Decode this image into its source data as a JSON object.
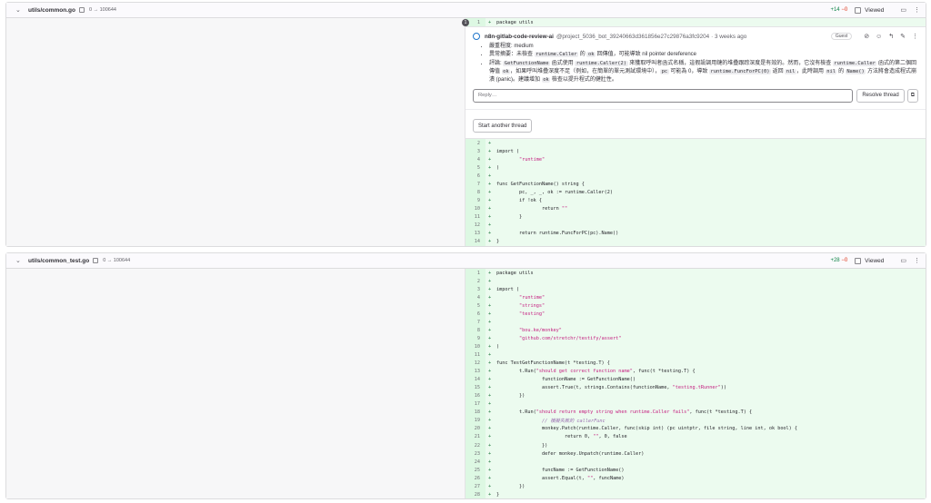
{
  "file1": {
    "name": "utils/common.go",
    "mode": "0 → 100644",
    "added": "+14",
    "removed": "−0",
    "viewed_label": "Viewed",
    "first_line": {
      "num": "1",
      "code": "package utils"
    },
    "comment_count": "1",
    "note": {
      "author": "n8n-gitlab-code-review-ai",
      "handle": "@project_5036_bot_39240663d361856e27c29876a3fc9204",
      "time": "· 3 weeks ago",
      "badge": "Guest",
      "bullet1": "嚴重程度: medium",
      "bullet2_pre": "異常摘要：未檢查 ",
      "bullet2_code1": "runtime.Caller",
      "bullet2_mid": " 的 ",
      "bullet2_code2": "ok",
      "bullet2_post": " 回傳值，可能導致 nil pointer dereference",
      "bullet3_a": "評論: ",
      "bullet3_c1": "GetFunctionName",
      "bullet3_b": " 函式使用 ",
      "bullet3_c2": "runtime.Caller(2)",
      "bullet3_d": " 來獲取呼叫者函式名稱，這假設調用鏈的堆疊跟踪深度是有效的。然而，它沒有檢查 ",
      "bullet3_c3": "runtime.Caller",
      "bullet3_e": " 函式的第二個回傳值 ",
      "bullet3_c4": "ok",
      "bullet3_f": "，如果呼叫堆疊深度不足（例如，在簡單的單元測試環境中），",
      "bullet3_c5": "pc",
      "bullet3_g": " 可能為 0，導致 ",
      "bullet3_c6": "runtime.FuncForPC(0)",
      "bullet3_h": " 返回 ",
      "bullet3_c7": "nil",
      "bullet3_i": "，此時調用 ",
      "bullet3_c8": "nil",
      "bullet3_j": " 的 ",
      "bullet3_c9": "Name()",
      "bullet3_k": " 方法將會造成程式崩潰 (panic)。建議增加 ",
      "bullet3_c10": "ok",
      "bullet3_l": " 檢查以提升程式的健壯性。",
      "reply_placeholder": "Reply…",
      "resolve_label": "Resolve thread",
      "start_thread_label": "Start another thread"
    },
    "lines": [
      {
        "num": "2",
        "parts": [
          {
            "t": ""
          }
        ]
      },
      {
        "num": "3",
        "parts": [
          {
            "t": "import ("
          }
        ]
      },
      {
        "num": "4",
        "parts": [
          {
            "t": "        "
          },
          {
            "t": "\"runtime\"",
            "c": "str"
          }
        ]
      },
      {
        "num": "5",
        "parts": [
          {
            "t": ")"
          }
        ]
      },
      {
        "num": "6",
        "parts": [
          {
            "t": ""
          }
        ]
      },
      {
        "num": "7",
        "parts": [
          {
            "t": "func GetFunctionName() string {"
          }
        ]
      },
      {
        "num": "8",
        "parts": [
          {
            "t": "        pc, _, _, ok := runtime.Caller(2)"
          }
        ]
      },
      {
        "num": "9",
        "parts": [
          {
            "t": "        if !ok {"
          }
        ]
      },
      {
        "num": "10",
        "parts": [
          {
            "t": "                return "
          },
          {
            "t": "\"\"",
            "c": "str"
          }
        ]
      },
      {
        "num": "11",
        "parts": [
          {
            "t": "        }"
          }
        ]
      },
      {
        "num": "12",
        "parts": [
          {
            "t": ""
          }
        ]
      },
      {
        "num": "13",
        "parts": [
          {
            "t": "        return runtime.FuncForPC(pc).Name()"
          }
        ]
      },
      {
        "num": "14",
        "parts": [
          {
            "t": "}"
          }
        ]
      }
    ]
  },
  "file2": {
    "name": "utils/common_test.go",
    "mode": "0 → 100644",
    "added": "+28",
    "removed": "−0",
    "viewed_label": "Viewed",
    "lines": [
      {
        "num": "1",
        "parts": [
          {
            "t": "package utils"
          }
        ]
      },
      {
        "num": "2",
        "parts": [
          {
            "t": ""
          }
        ]
      },
      {
        "num": "3",
        "parts": [
          {
            "t": "import ("
          }
        ]
      },
      {
        "num": "4",
        "parts": [
          {
            "t": "        "
          },
          {
            "t": "\"runtime\"",
            "c": "str"
          }
        ]
      },
      {
        "num": "5",
        "parts": [
          {
            "t": "        "
          },
          {
            "t": "\"strings\"",
            "c": "str"
          }
        ]
      },
      {
        "num": "6",
        "parts": [
          {
            "t": "        "
          },
          {
            "t": "\"testing\"",
            "c": "str"
          }
        ]
      },
      {
        "num": "7",
        "parts": [
          {
            "t": ""
          }
        ]
      },
      {
        "num": "8",
        "parts": [
          {
            "t": "        "
          },
          {
            "t": "\"bou.ke/monkey\"",
            "c": "str"
          }
        ]
      },
      {
        "num": "9",
        "parts": [
          {
            "t": "        "
          },
          {
            "t": "\"github.com/stretchr/testify/assert\"",
            "c": "str"
          }
        ]
      },
      {
        "num": "10",
        "parts": [
          {
            "t": ")"
          }
        ]
      },
      {
        "num": "11",
        "parts": [
          {
            "t": ""
          }
        ]
      },
      {
        "num": "12",
        "parts": [
          {
            "t": "func TestGetFunctionName(t *testing.T) {"
          }
        ]
      },
      {
        "num": "13",
        "parts": [
          {
            "t": "        t.Run("
          },
          {
            "t": "\"should get correct function name\"",
            "c": "str"
          },
          {
            "t": ", func(t *testing.T) {"
          }
        ]
      },
      {
        "num": "14",
        "parts": [
          {
            "t": "                functionName := GetFunctionName()"
          }
        ]
      },
      {
        "num": "15",
        "parts": [
          {
            "t": "                assert.True(t, strings.Contains(functionName, "
          },
          {
            "t": "\"testing.tRunner\"",
            "c": "str"
          },
          {
            "t": "))"
          }
        ]
      },
      {
        "num": "16",
        "parts": [
          {
            "t": "        })"
          }
        ]
      },
      {
        "num": "17",
        "parts": [
          {
            "t": ""
          }
        ]
      },
      {
        "num": "18",
        "parts": [
          {
            "t": "        t.Run("
          },
          {
            "t": "\"should return empty string when runtime.Caller fails\"",
            "c": "str"
          },
          {
            "t": ", func(t *testing.T) {"
          }
        ]
      },
      {
        "num": "19",
        "parts": [
          {
            "t": "                "
          },
          {
            "t": "// 模擬失敗的 callerFunc",
            "c": "cmt"
          }
        ]
      },
      {
        "num": "20",
        "parts": [
          {
            "t": "                monkey.Patch(runtime.Caller, func(skip int) (pc uintptr, file string, line int, ok bool) {"
          }
        ]
      },
      {
        "num": "21",
        "parts": [
          {
            "t": "                        return 0, "
          },
          {
            "t": "\"\"",
            "c": "str"
          },
          {
            "t": ", 0, false"
          }
        ]
      },
      {
        "num": "22",
        "parts": [
          {
            "t": "                })"
          }
        ]
      },
      {
        "num": "23",
        "parts": [
          {
            "t": "                defer monkey.Unpatch(runtime.Caller)"
          }
        ]
      },
      {
        "num": "24",
        "parts": [
          {
            "t": ""
          }
        ]
      },
      {
        "num": "25",
        "parts": [
          {
            "t": "                funcName := GetFunctionName()"
          }
        ]
      },
      {
        "num": "26",
        "parts": [
          {
            "t": "                assert.Equal(t, "
          },
          {
            "t": "\"\"",
            "c": "str"
          },
          {
            "t": ", funcName)"
          }
        ]
      },
      {
        "num": "27",
        "parts": [
          {
            "t": "        })"
          }
        ]
      },
      {
        "num": "28",
        "parts": [
          {
            "t": "}"
          }
        ]
      }
    ]
  }
}
